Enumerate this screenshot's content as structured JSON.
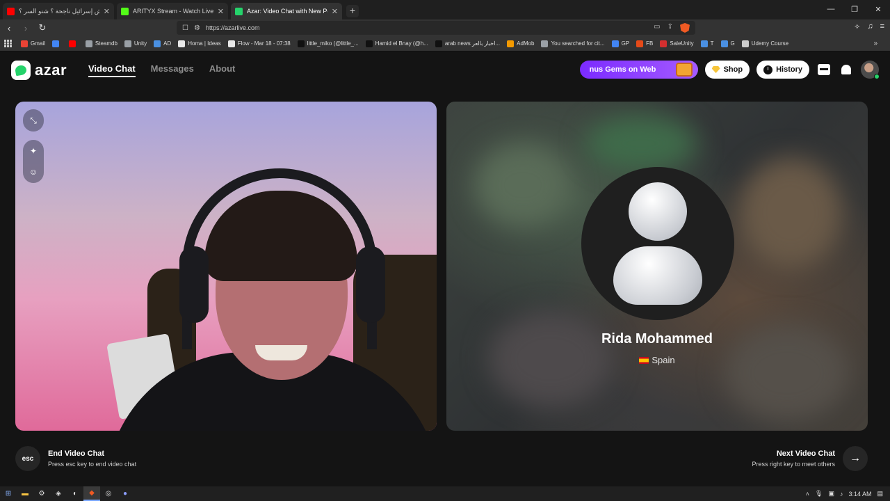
{
  "browser": {
    "tabs": [
      {
        "title": "علاش إسرائيل ناجحة ؟ شنو السر ؟ - ...be",
        "favicon_color": "#ff0000",
        "active": false
      },
      {
        "title": "ARITYX Stream - Watch Live on Kick",
        "favicon_color": "#53fc18",
        "active": false
      },
      {
        "title": "Azar: Video Chat with New Pe",
        "favicon_color": "#25d36b",
        "active": true
      }
    ],
    "new_tab": "+",
    "url": "https://azarlive.com",
    "bookmarks": [
      {
        "label": "Gmail",
        "color": "#ea4335"
      },
      {
        "label": "",
        "color": "#4285f4"
      },
      {
        "label": "",
        "color": "#ff0000"
      },
      {
        "label": "Steamdb",
        "color": "#9aa0a6"
      },
      {
        "label": "Unity",
        "color": "#9aa0a6"
      },
      {
        "label": "AD",
        "color": "#4a90e2"
      },
      {
        "label": "Homa | Ideas",
        "color": "#e8e8e8"
      },
      {
        "label": "Flow - Mar 18 - 07:38",
        "color": "#e8e8e8"
      },
      {
        "label": "little_miko (@little_...",
        "color": "#111111"
      },
      {
        "label": "Hamid el Bnay (@h...",
        "color": "#111111"
      },
      {
        "label": "arab news اخبار بالعر...",
        "color": "#111111"
      },
      {
        "label": "AdMob",
        "color": "#f29900"
      },
      {
        "label": "You searched for cit...",
        "color": "#9aa0a6"
      },
      {
        "label": "GP",
        "color": "#4285f4"
      },
      {
        "label": "FB",
        "color": "#e64a19"
      },
      {
        "label": "SaleUnity",
        "color": "#d32f2f"
      },
      {
        "label": "T",
        "color": "#4a90e2"
      },
      {
        "label": "G",
        "color": "#4a90e2"
      },
      {
        "label": "Udemy Course",
        "color": "#cccccc"
      }
    ]
  },
  "site": {
    "logo_text": "azar",
    "nav": [
      {
        "label": "Video Chat",
        "active": true
      },
      {
        "label": "Messages",
        "active": false
      },
      {
        "label": "About",
        "active": false
      }
    ],
    "promo_text": "nus Gems on Web",
    "shop_label": "Shop",
    "history_label": "History",
    "accent_color": "#25d36b"
  },
  "partner": {
    "name": "Rida Mohammed",
    "country": "Spain"
  },
  "footer": {
    "esc_label": "esc",
    "end_title": "End Video Chat",
    "end_sub": "Press esc key to end video chat",
    "next_title": "Next Video Chat",
    "next_sub": "Press right key to meet others"
  },
  "taskbar": {
    "time": "3:14 AM"
  }
}
